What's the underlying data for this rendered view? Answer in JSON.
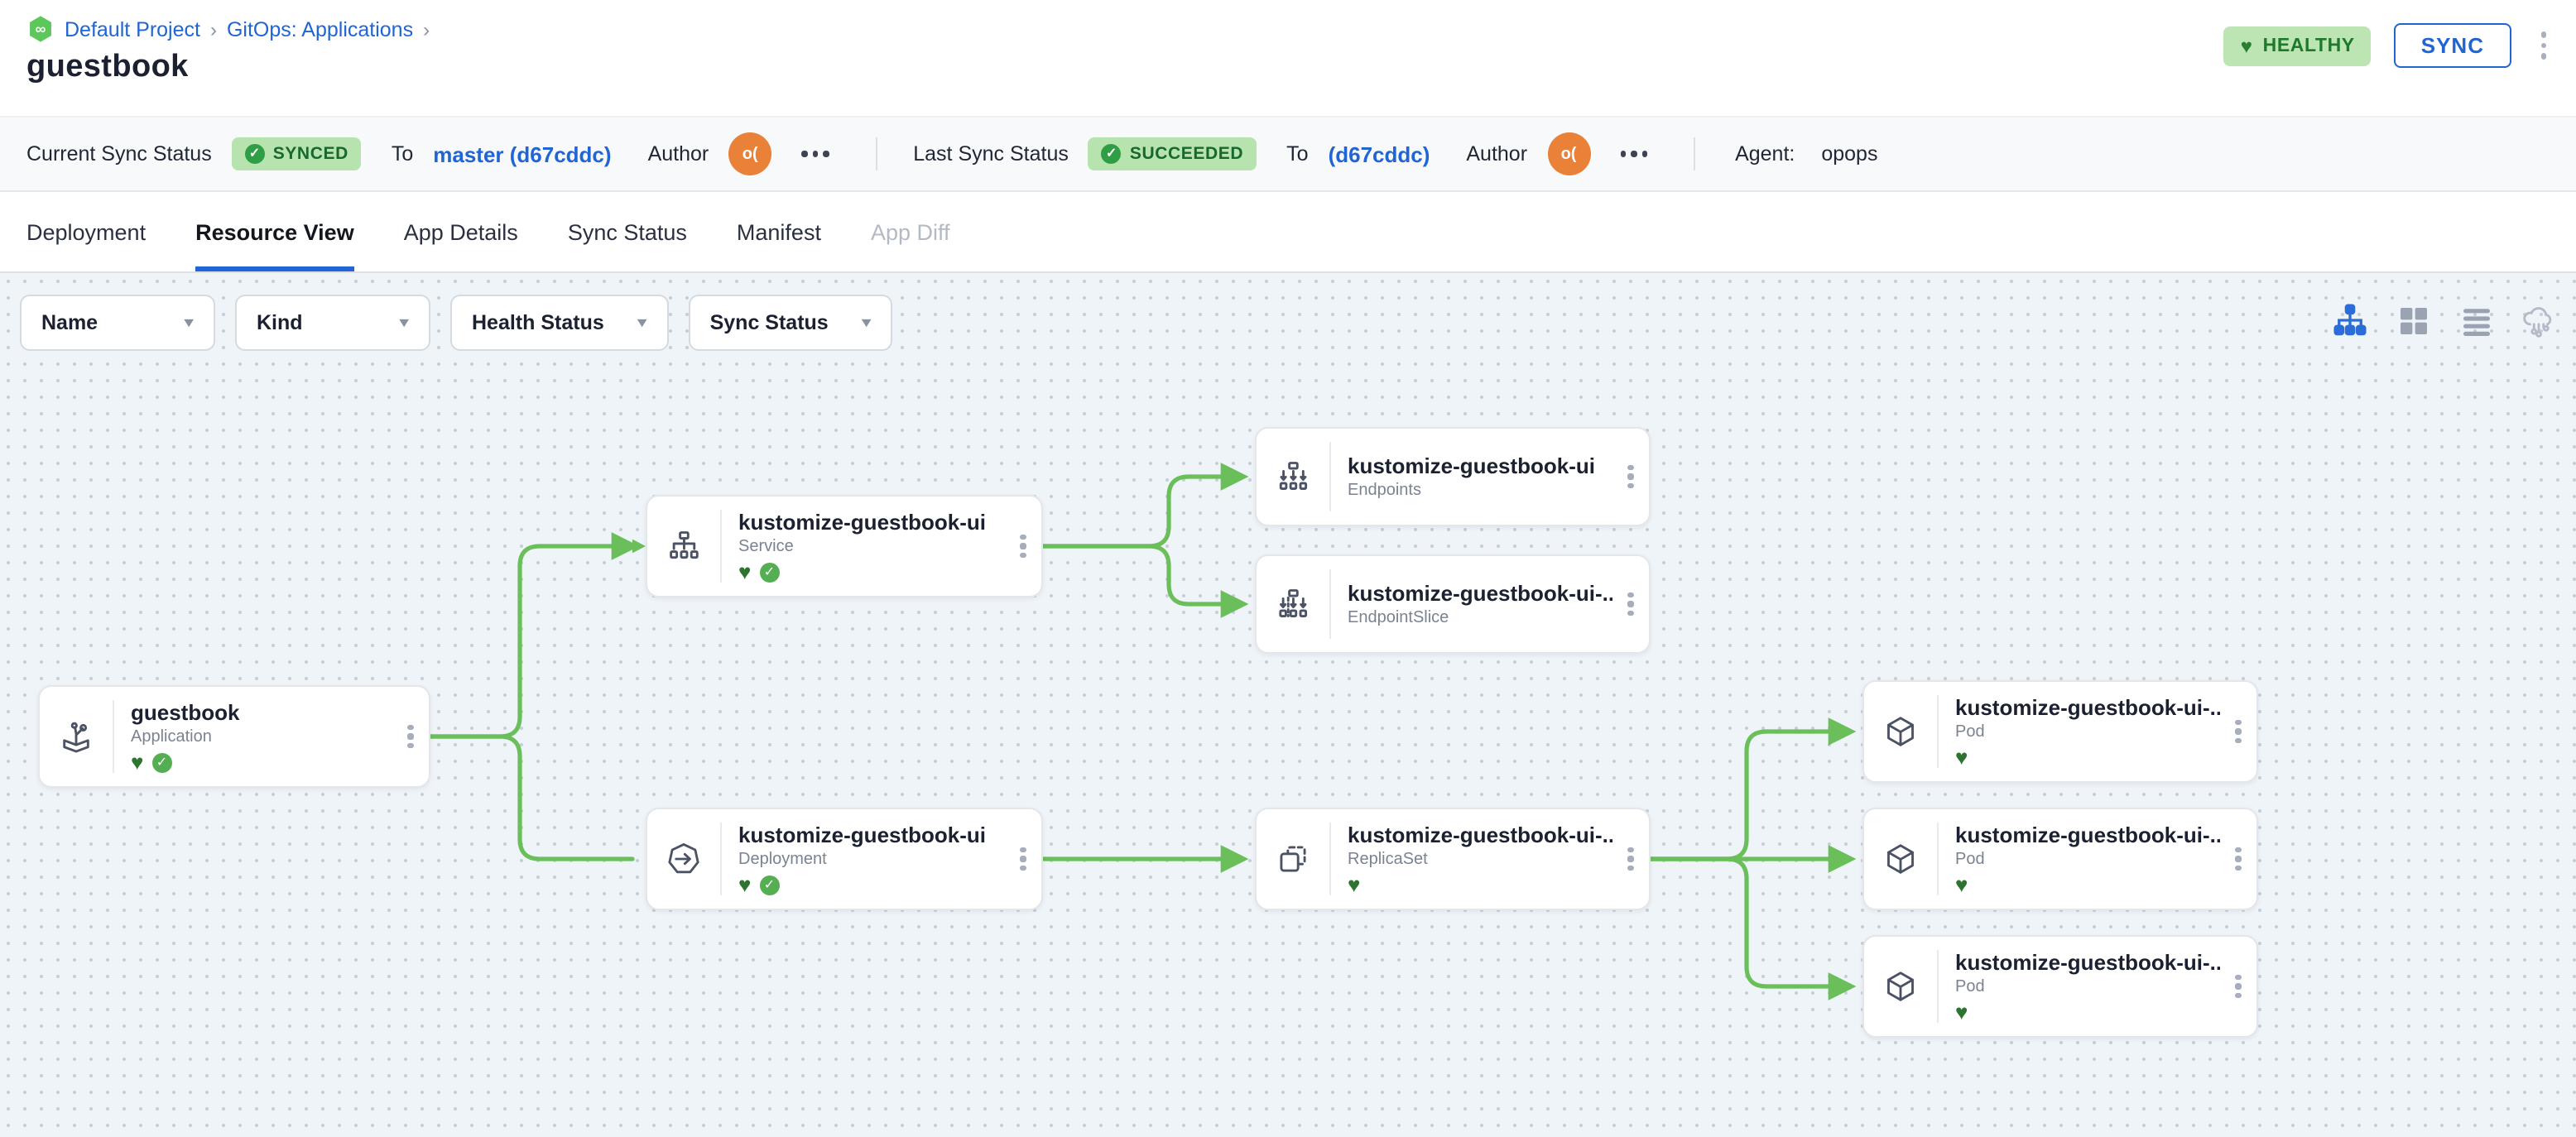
{
  "breadcrumb": {
    "logo_icon": "infinity-hexagon",
    "items": [
      "Default Project",
      "GitOps: Applications"
    ],
    "separator": "›"
  },
  "page_title": "guestbook",
  "header_actions": {
    "health_badge": "HEALTHY",
    "health_icon": "heart",
    "sync_button": "SYNC",
    "more_icon": "kebab-vertical"
  },
  "status_bar": {
    "current": {
      "label": "Current Sync Status",
      "badge": "SYNCED",
      "badge_icon": "check-circle",
      "to_label": "To",
      "target": "master (d67cddc)",
      "author_label": "Author",
      "author_avatar": "o(",
      "more_icon": "ellipsis"
    },
    "last": {
      "label": "Last Sync Status",
      "badge": "SUCCEEDED",
      "badge_icon": "check-circle",
      "to_label": "To",
      "target": "(d67cddc)",
      "author_label": "Author",
      "author_avatar": "o(",
      "more_icon": "ellipsis"
    },
    "agent": {
      "label": "Agent:",
      "value": "opops"
    }
  },
  "tabs": [
    {
      "label": "Deployment",
      "state": "normal"
    },
    {
      "label": "Resource View",
      "state": "active"
    },
    {
      "label": "App Details",
      "state": "normal"
    },
    {
      "label": "Sync Status",
      "state": "normal"
    },
    {
      "label": "Manifest",
      "state": "normal"
    },
    {
      "label": "App Diff",
      "state": "disabled"
    }
  ],
  "filters": [
    {
      "label": "Name"
    },
    {
      "label": "Kind"
    },
    {
      "label": "Health Status"
    },
    {
      "label": "Sync Status"
    }
  ],
  "view_modes": [
    {
      "icon": "hierarchy-view",
      "active": true
    },
    {
      "icon": "grid-view",
      "active": false
    },
    {
      "icon": "list-view",
      "active": false
    },
    {
      "icon": "cloud-topology-view",
      "active": false
    }
  ],
  "graph": {
    "nodes": [
      {
        "name": "guestbook",
        "kind": "Application",
        "icon": "application",
        "healthy": true,
        "synced": true
      },
      {
        "name": "kustomize-guestbook-ui",
        "kind": "Service",
        "icon": "service",
        "healthy": true,
        "synced": true
      },
      {
        "name": "kustomize-guestbook-ui",
        "kind": "Endpoints",
        "icon": "endpoints",
        "healthy": null,
        "synced": null
      },
      {
        "name": "kustomize-guestbook-ui-...",
        "kind": "EndpointSlice",
        "icon": "endpointslice",
        "healthy": null,
        "synced": null
      },
      {
        "name": "kustomize-guestbook-ui",
        "kind": "Deployment",
        "icon": "deployment",
        "healthy": true,
        "synced": true
      },
      {
        "name": "kustomize-guestbook-ui-...",
        "kind": "ReplicaSet",
        "icon": "replicaset",
        "healthy": true,
        "synced": null
      },
      {
        "name": "kustomize-guestbook-ui-...",
        "kind": "Pod",
        "icon": "pod",
        "healthy": true,
        "synced": null
      },
      {
        "name": "kustomize-guestbook-ui-...",
        "kind": "Pod",
        "icon": "pod",
        "healthy": true,
        "synced": null
      },
      {
        "name": "kustomize-guestbook-ui-...",
        "kind": "Pod",
        "icon": "pod",
        "healthy": true,
        "synced": null
      }
    ],
    "edges": [
      "guestbook→service",
      "guestbook→deployment",
      "service→endpoints",
      "service→endpointslice",
      "deployment→replicaset",
      "replicaset→pod-1",
      "replicaset→pod-2",
      "replicaset→pod-3"
    ]
  },
  "colors": {
    "link_blue": "#2065d4",
    "edge_green": "#6abf5a",
    "badge_green_bg": "#b7e3ae",
    "badge_green_text": "#17672e",
    "healthy_heart": "#2d7430",
    "avatar_orange": "#e98138",
    "canvas_bg": "#eff4f8"
  }
}
